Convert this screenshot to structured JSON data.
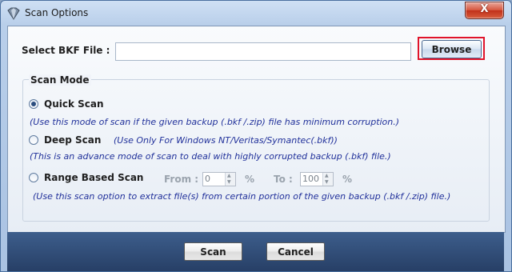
{
  "window": {
    "title": "Scan Options",
    "close_glyph": "X"
  },
  "file": {
    "label": "Select BKF File :",
    "value": "",
    "browse_label": "Browse"
  },
  "scan_mode": {
    "title": "Scan Mode",
    "options": [
      {
        "label": "Quick Scan",
        "selected": true,
        "description": "(Use this mode of scan if the given backup (.bkf /.zip) file has minimum corruption.)"
      },
      {
        "label": "Deep Scan",
        "selected": false,
        "note": "(Use Only For Windows NT/Veritas/Symantec(.bkf))",
        "description": "(This is an advance mode of scan to deal with highly corrupted backup (.bkf) file.)"
      },
      {
        "label": "Range Based Scan",
        "selected": false,
        "description": "(Use this scan option to extract file(s) from certain portion of the given backup (.bkf /.zip) file.)"
      }
    ],
    "range": {
      "from_label": "From :",
      "from_value": "0",
      "to_label": "To :",
      "to_value": "100",
      "unit": "%"
    }
  },
  "footer": {
    "scan_label": "Scan",
    "cancel_label": "Cancel"
  },
  "icons": {
    "app": "app-icon",
    "close": "close-icon"
  }
}
